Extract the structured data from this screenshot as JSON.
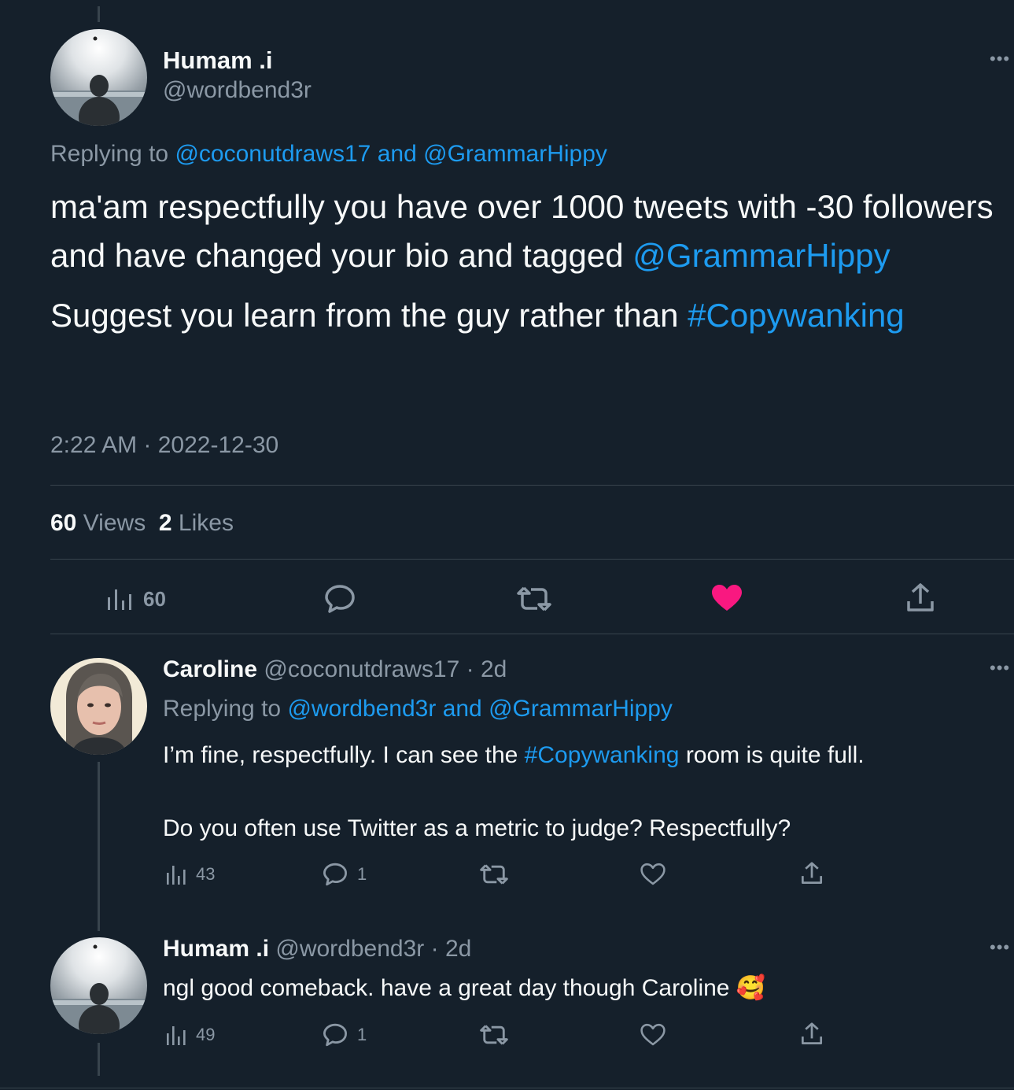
{
  "main_tweet": {
    "author_name": "Humam .i",
    "author_handle": "@wordbend3r",
    "replying_prefix": "Replying to",
    "replying_user1": "@coconutdraws17",
    "replying_and": "and",
    "replying_user2": "@GrammarHippy",
    "body_line1": "ma'am respectfully you have over 1000 tweets with -30 followers and have changed your bio and tagged",
    "body_mention": "@GrammarHippy",
    "body_line2": "Suggest you learn from the guy rather than",
    "body_hashtag": "#Copywanking",
    "timestamp": "2:22 AM · 2022-12-30",
    "views_count": "60",
    "views_label": "Views",
    "likes_count": "2",
    "likes_label": "Likes",
    "actions": {
      "views": "60"
    }
  },
  "reply1": {
    "author_name": "Caroline",
    "author_handle": "@coconutdraws17",
    "age": "· 2d",
    "replying_prefix": "Replying to",
    "replying_user1": "@wordbend3r",
    "replying_and": "and",
    "replying_user2": "@GrammarHippy",
    "text1_before": "I’m fine, respectfully. I can see the",
    "text1_hashtag": "#Copywanking",
    "text1_after": "room is quite full.",
    "text2": "Do you often use Twitter as a metric to judge? Respectfully?",
    "views": "43",
    "replies": "1"
  },
  "reply2": {
    "author_name": "Humam .i",
    "author_handle": "@wordbend3r",
    "age": "· 2d",
    "text": "ngl good comeback. have a great day though Caroline",
    "emoji": "🥰",
    "views": "49",
    "replies": "1"
  },
  "colors": {
    "background": "#15202b",
    "link": "#1d9bf0",
    "muted": "#8b98a5",
    "like_active": "#f91880"
  }
}
